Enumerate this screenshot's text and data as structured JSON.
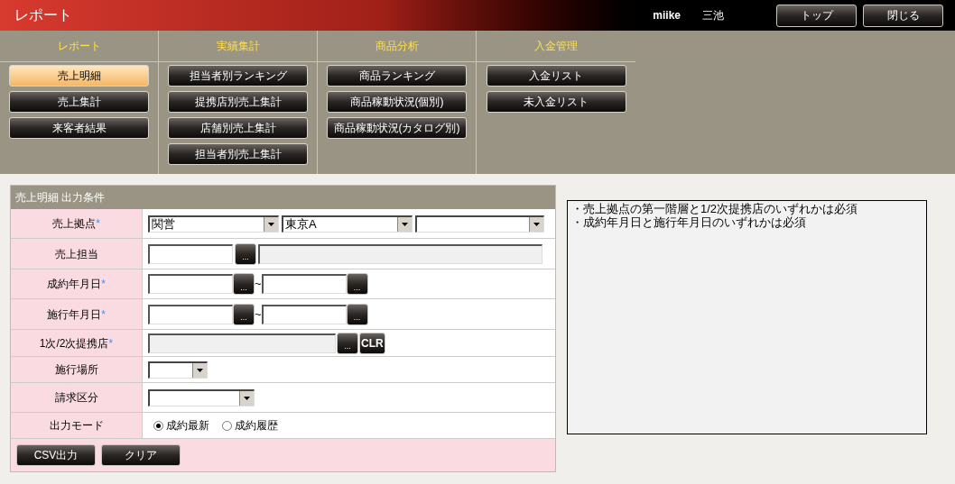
{
  "header": {
    "title": "レポート",
    "user_id": "miike",
    "user_name": "三池",
    "buttons": [
      "トップ",
      "閉じる"
    ]
  },
  "menu": [
    {
      "heading": "レポート",
      "items": [
        {
          "label": "売上明細",
          "selected": true
        },
        {
          "label": "売上集計",
          "selected": false
        },
        {
          "label": "来客者結果",
          "selected": false
        }
      ]
    },
    {
      "heading": "実績集計",
      "items": [
        {
          "label": "担当者別ランキング",
          "selected": false
        },
        {
          "label": "提携店別売上集計",
          "selected": false
        },
        {
          "label": "店舗別売上集計",
          "selected": false
        },
        {
          "label": "担当者別売上集計",
          "selected": false
        }
      ]
    },
    {
      "heading": "商品分析",
      "items": [
        {
          "label": "商品ランキング",
          "selected": false
        },
        {
          "label": "商品稼動状況(個別)",
          "selected": false
        },
        {
          "label": "商品稼動状況(カタログ別)",
          "selected": false
        }
      ]
    },
    {
      "heading": "入金管理",
      "items": [
        {
          "label": "入金リスト",
          "selected": false
        },
        {
          "label": "未入金リスト",
          "selected": false
        }
      ]
    }
  ],
  "form": {
    "title": "売上明細 出力条件",
    "rows": [
      {
        "label": "売上拠点",
        "required_mark": "*",
        "kind": "selects",
        "dropdowns": [
          {
            "kind": "dropdown",
            "value": "関営"
          },
          {
            "kind": "dropdown",
            "value": "東京A"
          },
          {
            "kind": "dropdown"
          }
        ]
      },
      {
        "label": "売上担当",
        "kind": "lookup",
        "button": "..."
      },
      {
        "label": "成約年月日",
        "required_mark": "*",
        "kind": "date_range",
        "button": "...",
        "separator": "~"
      },
      {
        "label": "施行年月日",
        "required_mark": "*",
        "kind": "date_range",
        "button": "...",
        "separator": "~"
      },
      {
        "label": "1次/2次提携店",
        "required_mark": "*",
        "kind": "partner",
        "button": "...",
        "clear": "CLR"
      },
      {
        "label": "施行場所",
        "kind": "select_small"
      },
      {
        "label": "請求区分",
        "kind": "select_medium"
      },
      {
        "label": "出力モード",
        "kind": "radio",
        "options": [
          {
            "label": "成約最新",
            "selected": true
          },
          {
            "label": "成約履歴",
            "selected": false
          }
        ]
      }
    ],
    "buttons": [
      "CSV出力",
      "クリア"
    ]
  },
  "notes": {
    "lines": [
      "・売上拠点の第一階層と1/2次提携店のいずれかは必須",
      "・成約年月日と施行年月日のいずれかは必須"
    ]
  }
}
